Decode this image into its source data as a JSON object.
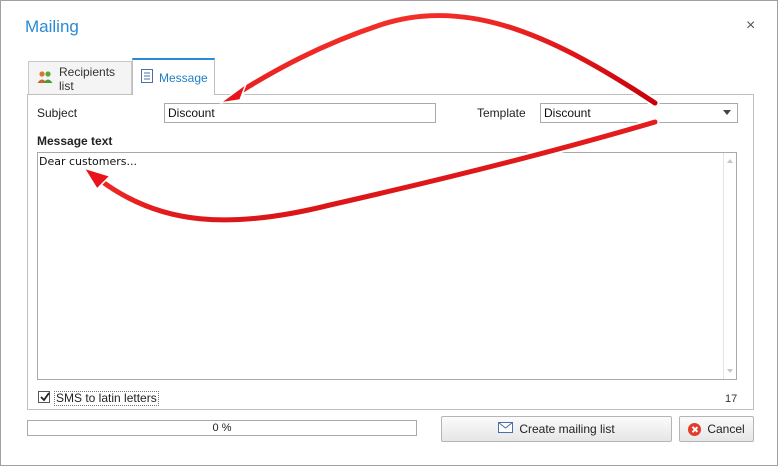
{
  "window": {
    "title": "Mailing",
    "close_glyph": "×"
  },
  "tabs": [
    {
      "label": "Recipients list",
      "icon": "people-icon",
      "active": false
    },
    {
      "label": "Message",
      "icon": "document-icon",
      "active": true
    }
  ],
  "form": {
    "subject_label": "Subject",
    "subject_value": "Discount",
    "template_label": "Template",
    "template_value": "Discount",
    "message_label": "Message text",
    "message_value": "Dear customers...",
    "sms_latin_label": "SMS to latin letters",
    "sms_latin_checked": true,
    "char_count": "17"
  },
  "progress": {
    "value": 0,
    "text": "0 %"
  },
  "buttons": {
    "create_label": "Create mailing list",
    "cancel_label": "Cancel"
  },
  "colors": {
    "accent": "#2a8ad4",
    "annotation_arrow": "#e8141b",
    "progress_fill": "#7ac143"
  }
}
